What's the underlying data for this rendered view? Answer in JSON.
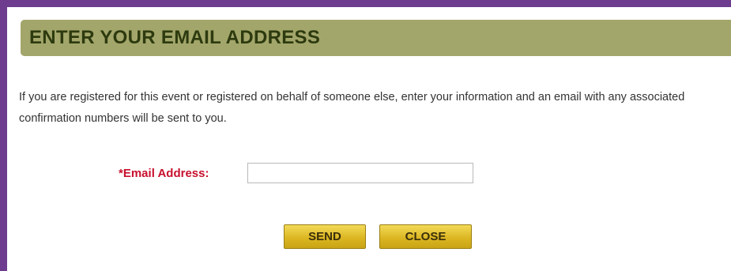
{
  "header": {
    "title": "ENTER YOUR EMAIL ADDRESS"
  },
  "description": {
    "text": "If you are registered for this event or registered on behalf of someone else, enter your information and an email with any associated confirmation numbers will be sent to you."
  },
  "form": {
    "email_label": "*Email Address:",
    "email_value": ""
  },
  "buttons": {
    "send_label": "SEND",
    "close_label": "CLOSE"
  },
  "colors": {
    "frame_border": "#6d3c8f",
    "header_bg": "#a3a66a",
    "header_text": "#2d3a0f",
    "required_label": "#c8102e",
    "button_gold": "#dcb723"
  }
}
